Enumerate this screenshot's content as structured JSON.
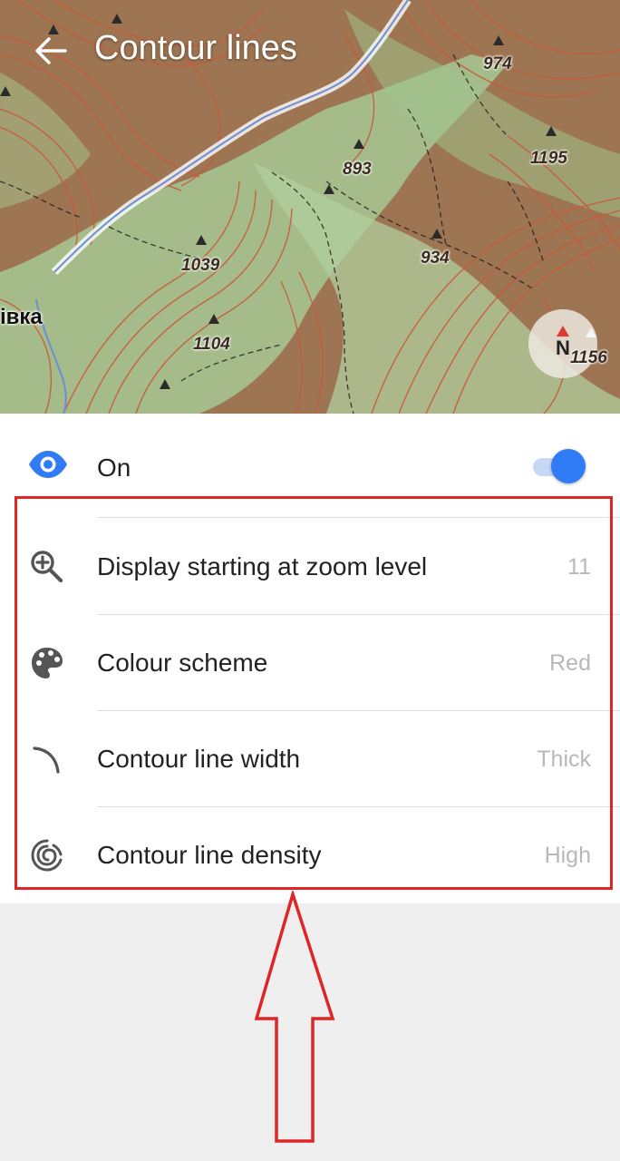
{
  "header": {
    "title": "Contour lines"
  },
  "map": {
    "town_label": "івка",
    "peaks": [
      "974",
      "893",
      "1195",
      "1039",
      "934",
      "1104",
      "1156"
    ],
    "compass_label": "N"
  },
  "layer_toggle": {
    "label": "On",
    "enabled": true
  },
  "settings": [
    {
      "icon": "zoom-in-icon",
      "label": "Display starting at zoom level",
      "value": "11"
    },
    {
      "icon": "palette-icon",
      "label": "Colour scheme",
      "value": "Red"
    },
    {
      "icon": "line-width-icon",
      "label": "Contour line width",
      "value": "Thick"
    },
    {
      "icon": "line-density-icon",
      "label": "Contour line density",
      "value": "High"
    }
  ],
  "colors": {
    "accent": "#2f7cf6",
    "highlight": "#e02525",
    "contour": "#c9593a",
    "terrain": "#a0774f",
    "meadow": "#a7c994"
  }
}
